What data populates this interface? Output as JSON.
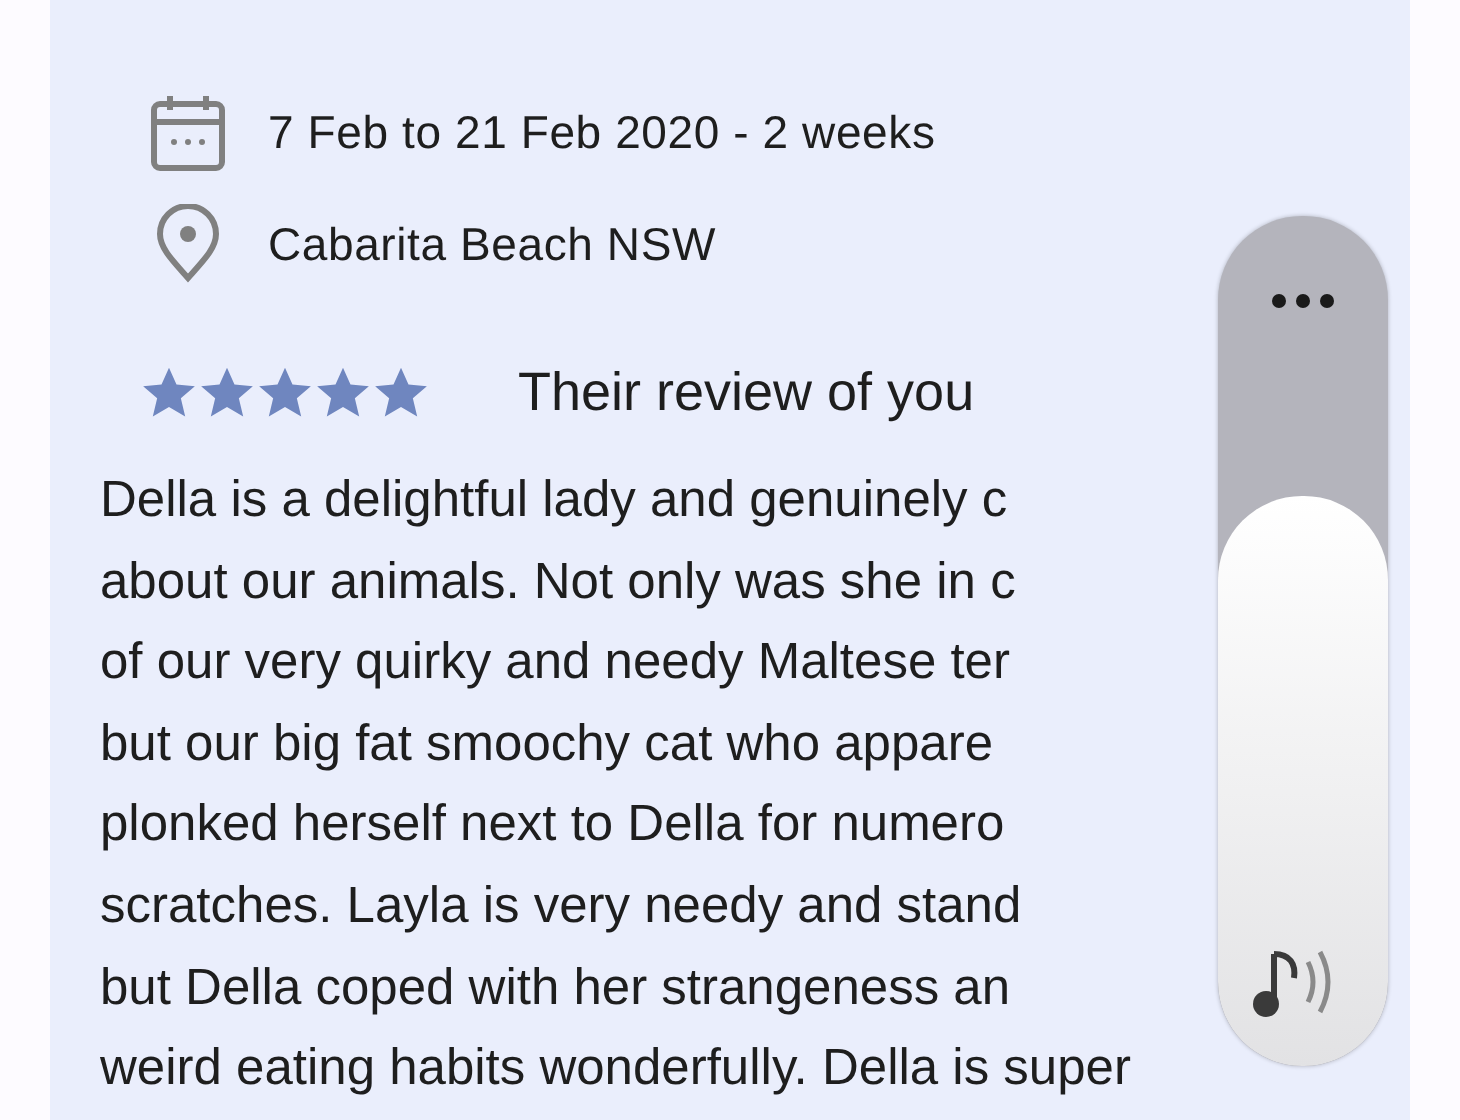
{
  "booking": {
    "dates": "7 Feb to 21 Feb 2020 - 2 weeks",
    "location": "Cabarita Beach NSW"
  },
  "review": {
    "stars": 5,
    "title": "Their review of you",
    "lines": [
      "Della is a delightful lady and genuinely c",
      "about our animals. Not only was she in c",
      "of our very quirky and needy Maltese ter",
      "but our big fat smoochy cat who appare",
      "plonked herself next to Della for numero",
      "scratches. Layla is very needy and stand",
      "but Della coped with her strangeness an",
      "weird eating habits wonderfully. Della is super"
    ]
  },
  "volume": {
    "level": 0.67
  }
}
